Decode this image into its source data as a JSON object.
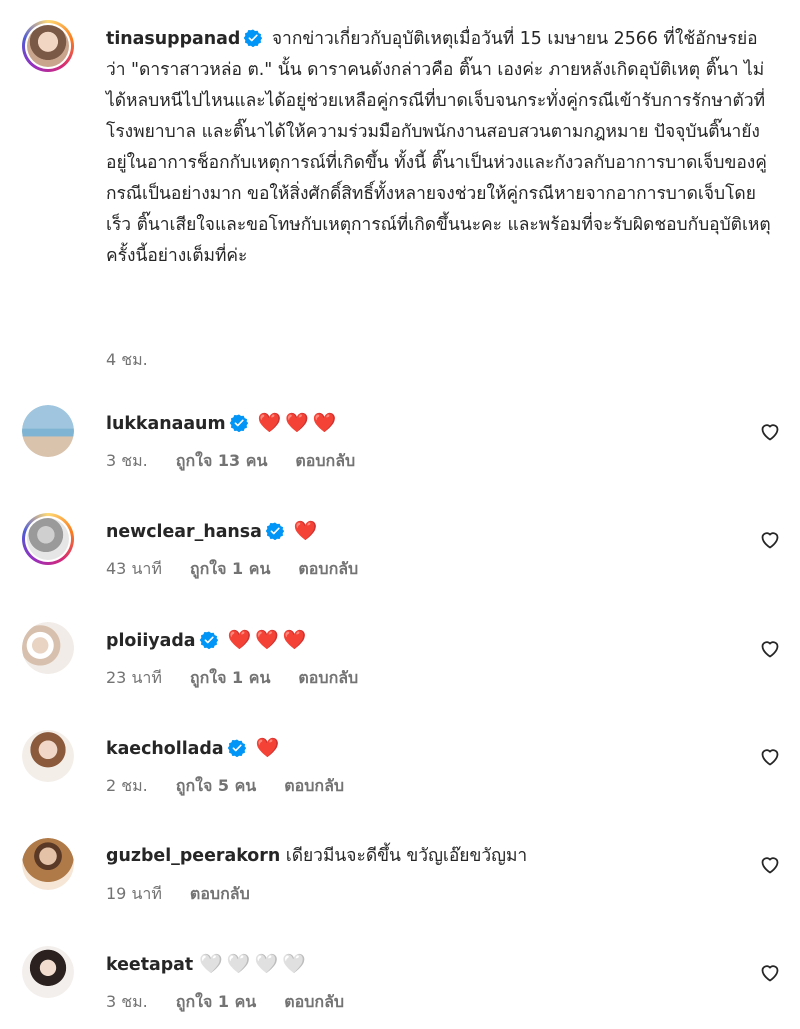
{
  "caption": {
    "username": "tinasuppanad",
    "text": "จากข่าวเกี่ยวกับอุบัติเหตุเมื่อวันที่ 15 เมษายน 2566 ที่ใช้อักษรย่อว่า \"ดาราสาวหล่อ ต.\" นั้น ดาราคนดังกล่าวคือ ติ๊นา เองค่ะ ภายหลังเกิดอุบัติเหตุ ติ๊นา ไม่ได้หลบหนีไปไหนและได้อยู่ช่วยเหลือคู่กรณีที่บาดเจ็บจนกระทั่งคู่กรณีเข้ารับการรักษาตัวที่โรงพยาบาล และติ๊นาได้ให้ความร่วมมือกับพนักงานสอบสวนตามกฎหมาย ปัจจุบันติ๊นายังอยู่ในอาการช็อกกับเหตุการณ์ที่เกิดขึ้น ทั้งนี้ ติ๊นาเป็นห่วงและกังวลกับอาการบาดเจ็บของคู่กรณีเป็นอย่างมาก ขอให้สิ่งศักดิ์สิทธิ์ทั้งหลายจงช่วยให้คู่กรณีหายจากอาการบาดเจ็บโดยเร็ว ติ๊นาเสียใจและขอโทษกับเหตุการณ์ที่เกิดขึ้นนะคะ และพร้อมที่จะรับผิดชอบกับอุบัติเหตุครั้งนี้อย่างเต็มที่ค่ะ",
    "time": "4 ชม."
  },
  "comments": [
    {
      "username": "lukkanaaum",
      "text": "",
      "hearts": "❤️❤️❤️",
      "time": "3 ชม.",
      "likes": "ถูกใจ 13 คน",
      "reply": "ตอบกลับ"
    },
    {
      "username": "newclear_hansa",
      "text": "",
      "hearts": "❤️",
      "time": "43 นาที",
      "likes": "ถูกใจ 1 คน",
      "reply": "ตอบกลับ"
    },
    {
      "username": "ploiiyada",
      "text": "",
      "hearts": "❤️❤️❤️",
      "time": "23 นาที",
      "likes": "ถูกใจ 1 คน",
      "reply": "ตอบกลับ"
    },
    {
      "username": "kaechollada",
      "text": "",
      "hearts": "❤️",
      "time": "2 ชม.",
      "likes": "ถูกใจ 5 คน",
      "reply": "ตอบกลับ"
    },
    {
      "username": "guzbel_peerakorn",
      "text": "เดียวมีนจะดีขึ้น ขวัญเอ๊ยขวัญมา",
      "hearts": "",
      "time": "19 นาที",
      "likes": "",
      "reply": "ตอบกลับ"
    },
    {
      "username": "keetapat",
      "text": "",
      "hearts": "🤍🤍🤍🤍",
      "time": "3 ชม.",
      "likes": "ถูกใจ 1 คน",
      "reply": "ตอบกลับ"
    }
  ],
  "colors": {
    "verified": "#0095f6",
    "heart": "#ed1d3a",
    "meta": "#737373",
    "text": "#262626"
  },
  "icons": {
    "verified": "verified-badge-icon",
    "like": "heart-outline-icon"
  }
}
